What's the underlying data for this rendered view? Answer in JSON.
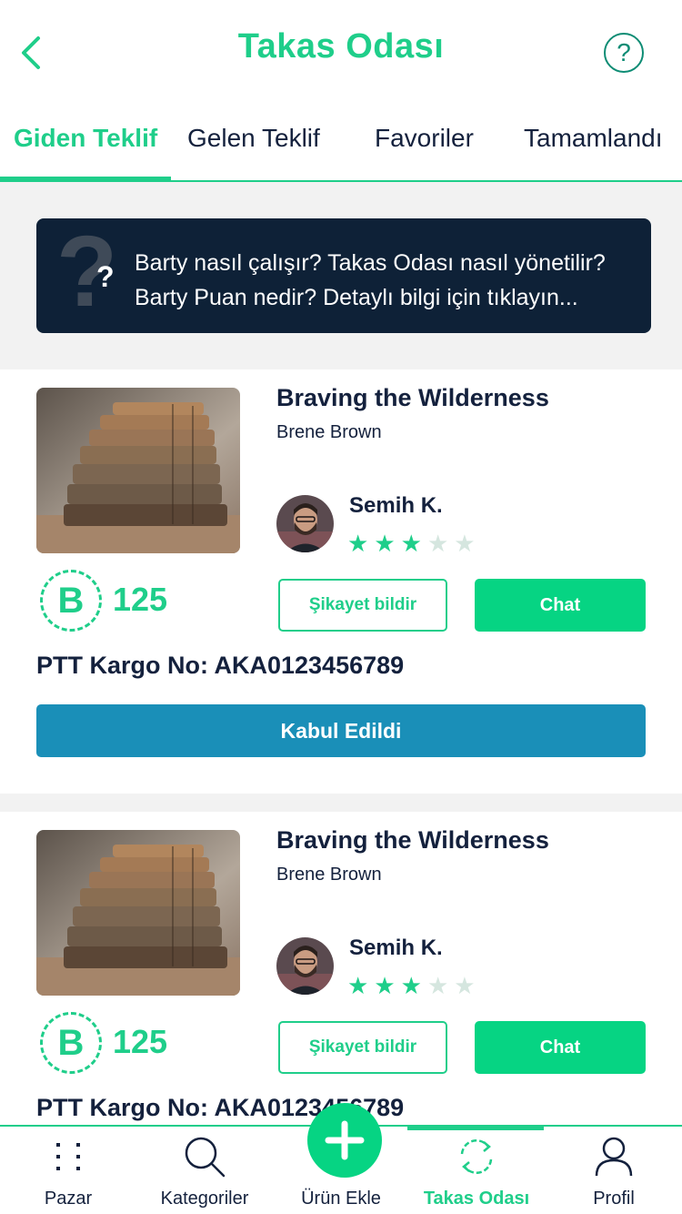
{
  "header": {
    "title": "Takas Odası",
    "back_icon": "chevron-left-icon",
    "help_icon": "question-circle-icon",
    "help_glyph": "?"
  },
  "tabs": [
    {
      "label": "Giden Teklif",
      "active": true
    },
    {
      "label": "Gelen Teklif",
      "active": false
    },
    {
      "label": "Favoriler",
      "active": false
    },
    {
      "label": "Tamamlandı",
      "active": false
    }
  ],
  "banner": {
    "line1": "Barty nasıl çalışır? Takas Odası nasıl yönetilir?",
    "line2": "Barty Puan nedir? Detaylı bilgi için tıklayın...",
    "icon": "question-mark-icon"
  },
  "offers": [
    {
      "book_title": "Braving the Wilderness",
      "author": "Brene Brown",
      "user_name": "Semih K.",
      "rating": 3,
      "rating_max": 5,
      "points_symbol": "B",
      "points": "125",
      "complain_label": "Şikayet bildir",
      "chat_label": "Chat",
      "cargo": "PTT Kargo No: AKA0123456789",
      "status_label": "Kabul Edildi"
    },
    {
      "book_title": "Braving the Wilderness",
      "author": "Brene Brown",
      "user_name": "Semih K.",
      "rating": 3,
      "rating_max": 5,
      "points_symbol": "B",
      "points": "125",
      "complain_label": "Şikayet bildir",
      "chat_label": "Chat",
      "cargo": "PTT Kargo No: AKA0123456789"
    }
  ],
  "bottom_nav": [
    {
      "label": "Pazar",
      "icon": "grid-dots-icon",
      "active": false
    },
    {
      "label": "Kategoriler",
      "icon": "search-icon",
      "active": false
    },
    {
      "label": "Ürün Ekle",
      "icon": "plus-icon",
      "active": false
    },
    {
      "label": "Takas Odası",
      "icon": "swap-arrows-icon",
      "active": true
    },
    {
      "label": "Profil",
      "icon": "user-icon",
      "active": false
    }
  ],
  "colors": {
    "brand_green": "#1fce8a",
    "button_green": "#06d483",
    "navy": "#0e2137",
    "accepted_blue": "#1a8fb8",
    "star_off": "#d5e6df"
  }
}
